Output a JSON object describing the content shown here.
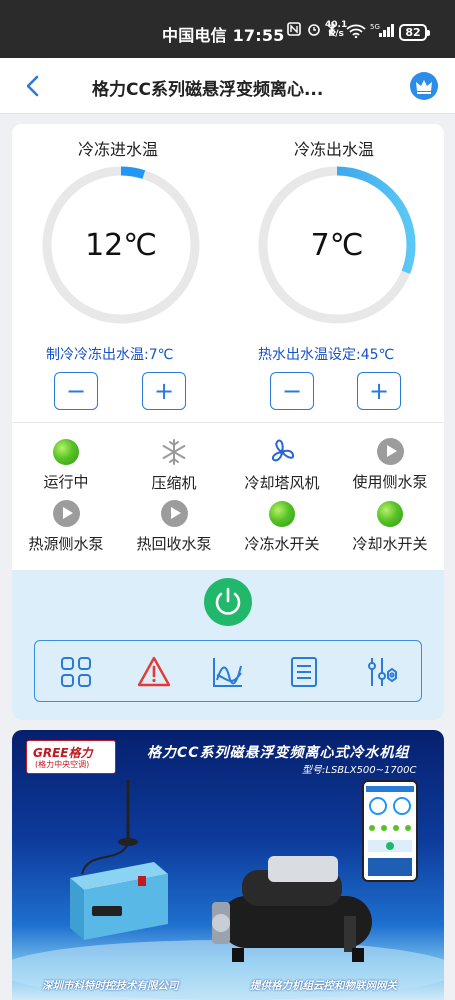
{
  "statusbar": {
    "carrier_time": "中国电信 17:55",
    "net_speed_value": "40.1",
    "net_speed_unit": "K/s",
    "signal_label": "5G",
    "battery": "82"
  },
  "header": {
    "title": "格力CC系列磁悬浮变频离心..."
  },
  "gauges": [
    {
      "title": "冷冻进水温",
      "value": "12℃",
      "level": 0.05
    },
    {
      "title": "冷冻出水温",
      "value": "7℃",
      "level": 0.31
    }
  ],
  "setpoints": {
    "cooling": "制冷冷冻出水温:7℃",
    "heating": "热水出水温设定:45℃"
  },
  "status_items": [
    {
      "label": "运行中",
      "icon": "green-dot-icon"
    },
    {
      "label": "压缩机",
      "icon": "snowflake-icon"
    },
    {
      "label": "冷却塔风机",
      "icon": "fan-icon"
    },
    {
      "label": "使用侧水泵",
      "icon": "pump-icon"
    },
    {
      "label": "热源侧水泵",
      "icon": "pump-icon"
    },
    {
      "label": "热回收水泵",
      "icon": "pump-icon"
    },
    {
      "label": "冷冻水开关",
      "icon": "green-dot-icon"
    },
    {
      "label": "冷却水开关",
      "icon": "green-dot-icon"
    }
  ],
  "colors": {
    "accent": "#2a7ad8",
    "setpoint_text": "#1652c8",
    "running_green": "#57c226",
    "power_green": "#22b86b",
    "gauge_track": "#e8e8e8",
    "gauge_fill": "#2196f3"
  },
  "toolbar": [
    "grid-icon",
    "alarm-icon",
    "chart-icon",
    "list-icon",
    "settings-icon"
  ],
  "banner": {
    "brand": "GREE格力",
    "brand_sub": "(格力中央空调)",
    "title": "格力CC系列磁悬浮变频离心式冷水机组",
    "model": "型号:LSBLX500~1700C",
    "footer_left": "深圳市科特时控技术有限公司",
    "footer_right": "提供格力机组云控和物联网网关"
  }
}
